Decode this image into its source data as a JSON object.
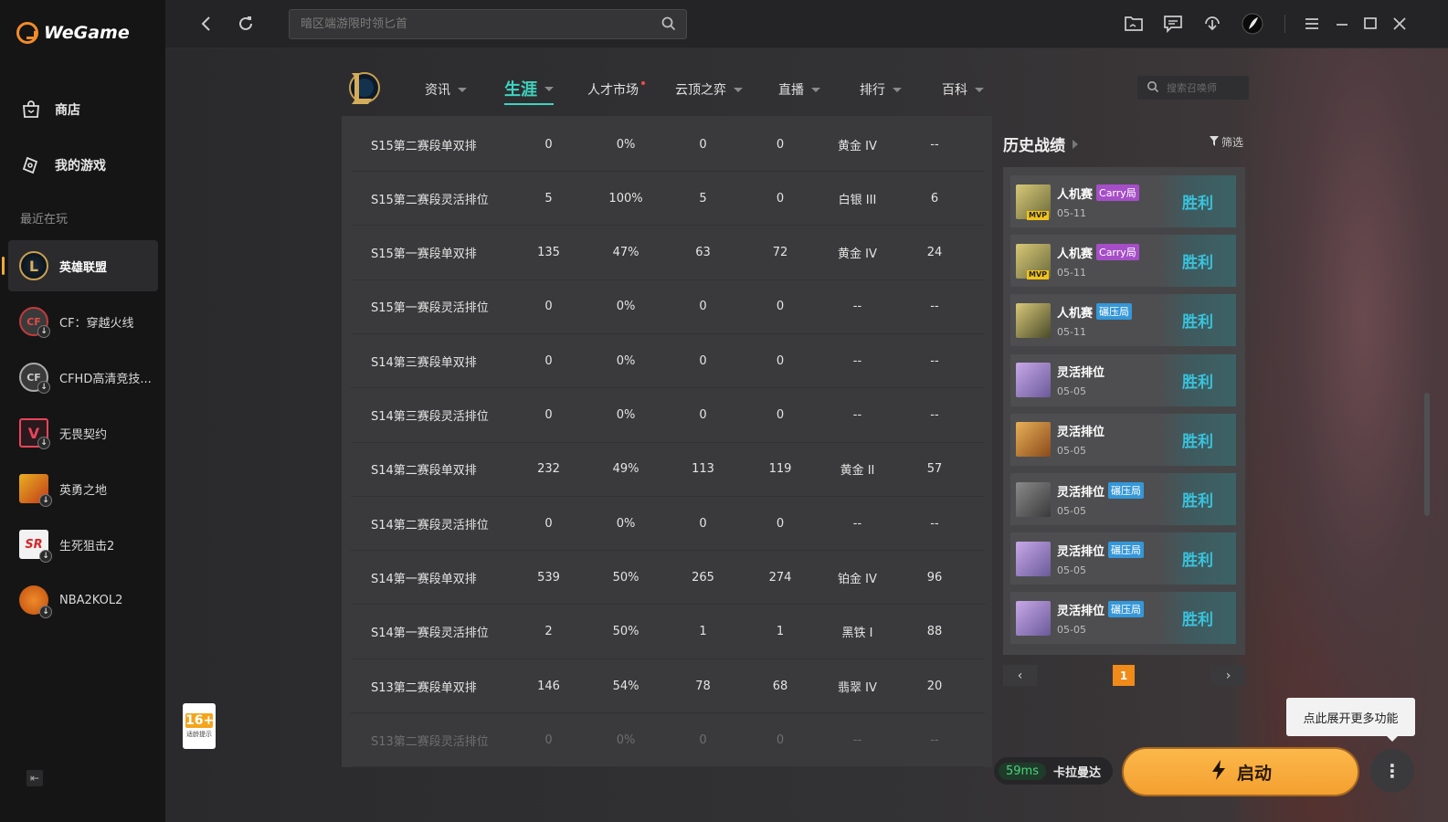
{
  "app": {
    "name": "WeGame"
  },
  "sidebar": {
    "nav": [
      {
        "label": "商店",
        "icon": "store-icon"
      },
      {
        "label": "我的游戏",
        "icon": "gamepad-icon"
      }
    ],
    "recent_label": "最近在玩",
    "games": [
      {
        "label": "英雄联盟",
        "active": true
      },
      {
        "label": "CF：穿越火线"
      },
      {
        "label": "CFHD高清竞技..."
      },
      {
        "label": "无畏契约"
      },
      {
        "label": "英勇之地"
      },
      {
        "label": "生死狙击2"
      },
      {
        "label": "NBA2KOL2"
      }
    ],
    "age": {
      "num": "16+",
      "label": "适龄提示"
    }
  },
  "topbar": {
    "search_placeholder": "暗区端游限时领匕首"
  },
  "game_nav": {
    "items": [
      "资讯",
      "生涯",
      "人才市场",
      "云顶之弈",
      "直播",
      "排行",
      "百科"
    ],
    "active": "生涯",
    "summoner_search_placeholder": "搜索召唤师"
  },
  "table": {
    "rows": [
      [
        "S15第二赛段单双排",
        "0",
        "0%",
        "0",
        "0",
        "黄金 IV",
        "--"
      ],
      [
        "S15第二赛段灵活排位",
        "5",
        "100%",
        "5",
        "0",
        "白银 III",
        "6"
      ],
      [
        "S15第一赛段单双排",
        "135",
        "47%",
        "63",
        "72",
        "黄金 IV",
        "24"
      ],
      [
        "S15第一赛段灵活排位",
        "0",
        "0%",
        "0",
        "0",
        "--",
        "--"
      ],
      [
        "S14第三赛段单双排",
        "0",
        "0%",
        "0",
        "0",
        "--",
        "--"
      ],
      [
        "S14第三赛段灵活排位",
        "0",
        "0%",
        "0",
        "0",
        "--",
        "--"
      ],
      [
        "S14第二赛段单双排",
        "232",
        "49%",
        "113",
        "119",
        "黄金 II",
        "57"
      ],
      [
        "S14第二赛段灵活排位",
        "0",
        "0%",
        "0",
        "0",
        "--",
        "--"
      ],
      [
        "S14第一赛段单双排",
        "539",
        "50%",
        "265",
        "274",
        "铂金 IV",
        "96"
      ],
      [
        "S14第一赛段灵活排位",
        "2",
        "50%",
        "1",
        "1",
        "黑铁 I",
        "88"
      ],
      [
        "S13第二赛段单双排",
        "146",
        "54%",
        "78",
        "68",
        "翡翠 IV",
        "20"
      ],
      [
        "S13第二赛段灵活排位",
        "0",
        "0%",
        "0",
        "0",
        "--",
        "--"
      ]
    ]
  },
  "history": {
    "title": "历史战绩",
    "filter_label": "筛选",
    "matches": [
      {
        "type": "人机赛",
        "tag": "Carry局",
        "date": "05-11",
        "result": "胜利",
        "mvp": "MVP"
      },
      {
        "type": "人机赛",
        "tag": "Carry局",
        "date": "05-11",
        "result": "胜利",
        "mvp": "MVP"
      },
      {
        "type": "人机赛",
        "tag": "碾压局",
        "date": "05-11",
        "result": "胜利"
      },
      {
        "type": "灵活排位",
        "tag": "",
        "date": "05-05",
        "result": "胜利"
      },
      {
        "type": "灵活排位",
        "tag": "",
        "date": "05-05",
        "result": "胜利"
      },
      {
        "type": "灵活排位",
        "tag": "碾压局",
        "date": "05-05",
        "result": "胜利"
      },
      {
        "type": "灵活排位",
        "tag": "碾压局",
        "date": "05-05",
        "result": "胜利"
      },
      {
        "type": "灵活排位",
        "tag": "碾压局",
        "date": "05-05",
        "result": "胜利"
      }
    ],
    "page": "1"
  },
  "bottom": {
    "ping": "59ms",
    "server": "卡拉曼达",
    "launch_label": "启动",
    "tooltip": "点此展开更多功能"
  },
  "colors": {
    "accent_orange": "#f4a030",
    "nav_active": "#3fd3c0",
    "win_text": "#38c3dd",
    "carry_tag": "#a64ec8",
    "crush_tag": "#3597d8"
  }
}
